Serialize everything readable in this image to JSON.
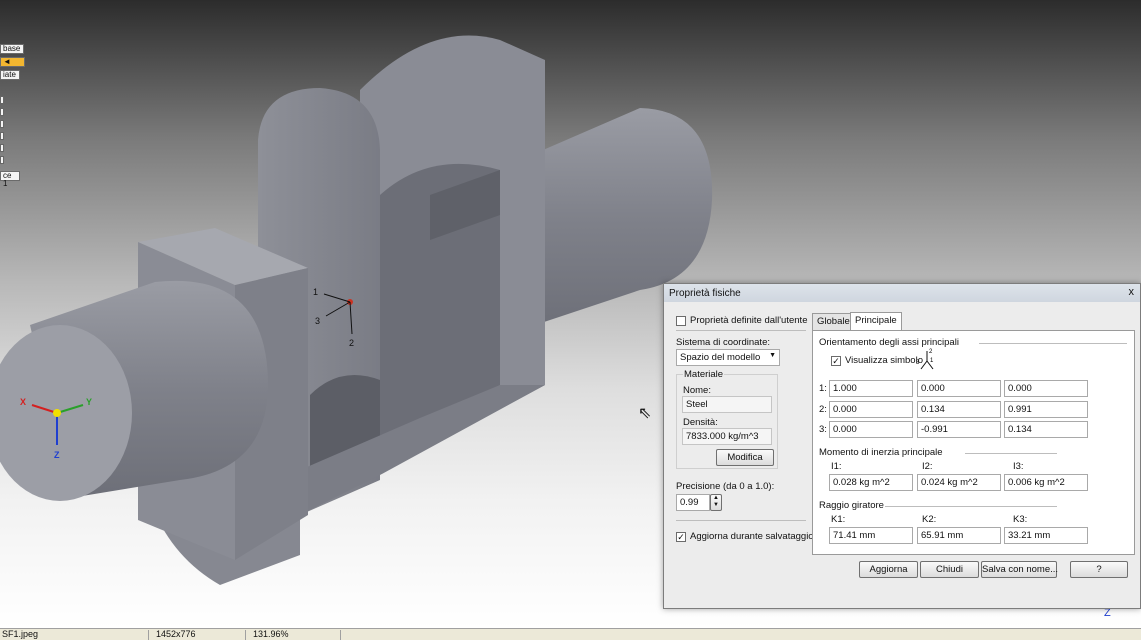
{
  "left_toolbar": {
    "btn_base": "base",
    "btn_date": "iate",
    "btn_ce1": "ce 1"
  },
  "triad_labels": {
    "one": "1",
    "two": "2",
    "three": "3"
  },
  "view_axes": {
    "x": "X",
    "y": "Y",
    "z": "Z"
  },
  "corner_mark": "Z",
  "dialog": {
    "title": "Proprietà fisiche",
    "close_glyph": "x",
    "user_defined_label": "Proprietà definite dall'utente",
    "coord_system_label": "Sistema di coordinate:",
    "coord_system_value": "Spazio del modello",
    "material_group_label": "Materiale",
    "name_label": "Nome:",
    "name_value": "Steel",
    "density_label": "Densità:",
    "density_value": "7833.000 kg/m^3",
    "modify_button": "Modifica",
    "precision_label": "Precisione (da 0 a 1.0):",
    "precision_value": "0.99",
    "update_on_save_label": "Aggiorna durante salvataggio",
    "tabs": [
      "Globale",
      "Principale"
    ],
    "orientation_header": "Orientamento degli assi principali",
    "show_symbol_label": "Visualizza simbolo",
    "matrix": [
      {
        "label": "1:",
        "values": [
          "1.000",
          "0.000",
          "0.000"
        ]
      },
      {
        "label": "2:",
        "values": [
          "0.000",
          "0.134",
          "0.991"
        ]
      },
      {
        "label": "3:",
        "values": [
          "0.000",
          "-0.991",
          "0.134"
        ]
      }
    ],
    "inertia_header": "Momento di inerzia principale",
    "inertia": [
      {
        "label": "I1:",
        "value": "0.028 kg m^2"
      },
      {
        "label": "I2:",
        "value": "0.024 kg m^2"
      },
      {
        "label": "I3:",
        "value": "0.006 kg m^2"
      }
    ],
    "gyration_header": "Raggio giratore",
    "gyration": [
      {
        "label": "K1:",
        "value": "71.41 mm"
      },
      {
        "label": "K2:",
        "value": "65.91 mm"
      },
      {
        "label": "K3:",
        "value": "33.21 mm"
      }
    ],
    "buttons": {
      "update": "Aggiorna",
      "close": "Chiudi",
      "save_as": "Salva con nome...",
      "help": "?"
    }
  },
  "statusbar": {
    "file": "SF1.jpeg",
    "size": "1452x776",
    "zoom": "131.96%"
  },
  "colors": {
    "model_gray": "#8c8e96",
    "dialog_bg": "#ececec",
    "x_axis": "#d42020",
    "y_axis": "#2aa02a",
    "z_axis": "#1f3fd0"
  }
}
